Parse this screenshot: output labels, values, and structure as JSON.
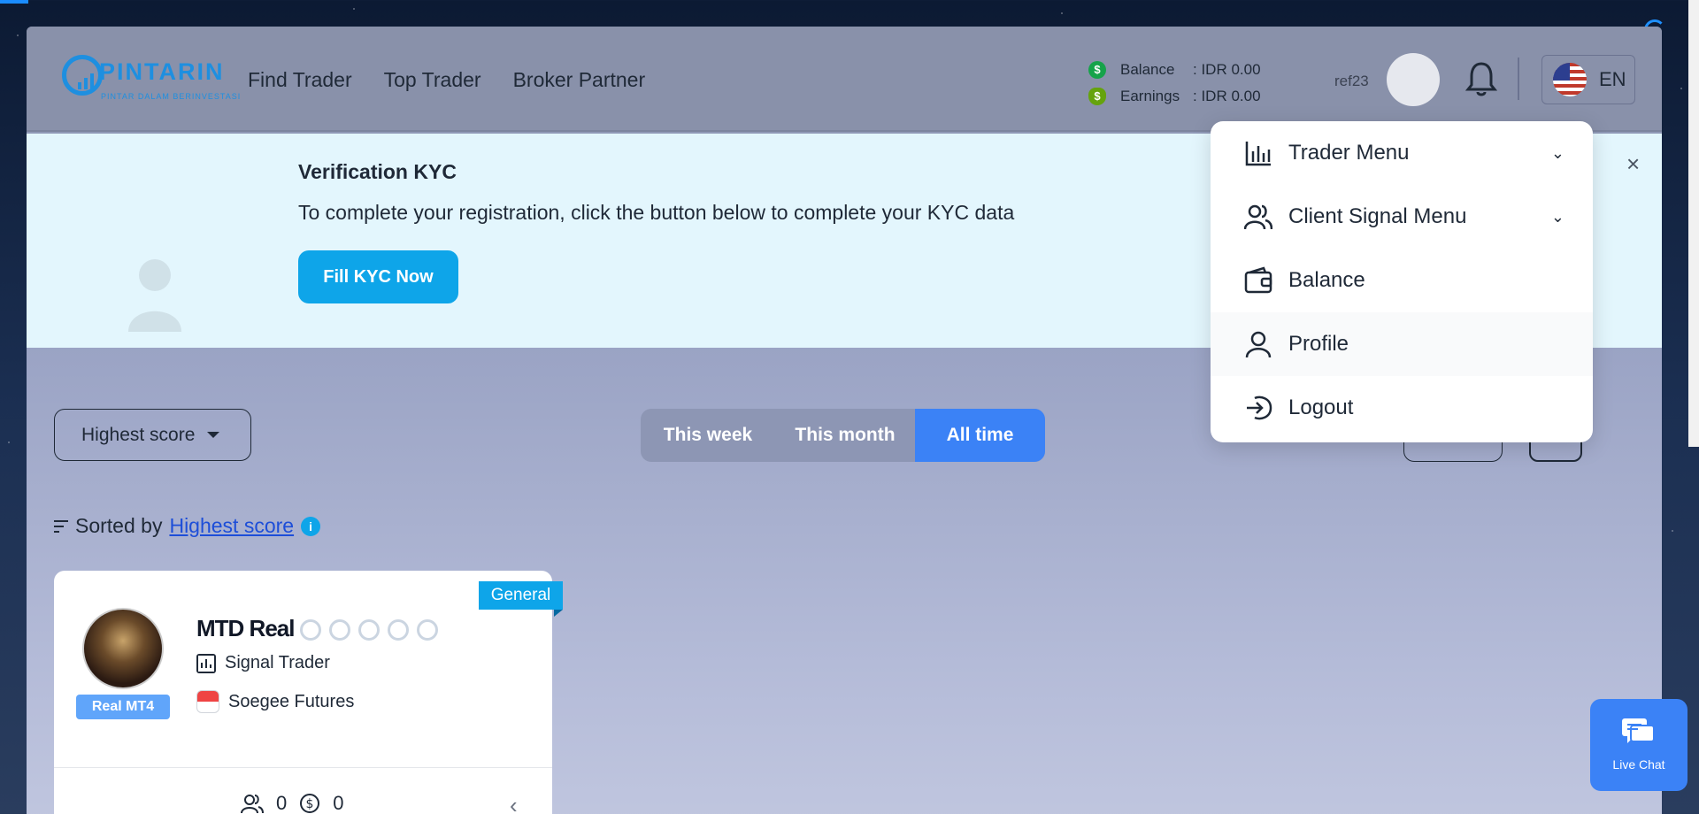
{
  "header": {
    "logo_text": "PINTARIN",
    "logo_tagline": "PINTAR DALAM BERINVESTASI",
    "nav": [
      "Find Trader",
      "Top Trader",
      "Broker Partner"
    ],
    "balance_label": "Balance",
    "balance_value": ": IDR 0.00",
    "earnings_label": "Earnings",
    "earnings_value": ": IDR 0.00",
    "ref": "ref23",
    "language": "EN"
  },
  "kyc": {
    "title": "Verification KYC",
    "description": "To complete your registration, click the button below to complete your KYC data",
    "button": "Fill KYC Now",
    "close": "×"
  },
  "filters": {
    "sort_label": "Highest score",
    "periods": [
      "This week",
      "This month",
      "All time"
    ],
    "active_period": "All time",
    "sorted_by_prefix": "Sorted by",
    "sorted_by_value": "Highest score",
    "info": "i"
  },
  "card": {
    "tag": "General",
    "name": "MTD Real",
    "account_badge": "Real MT4",
    "role": "Signal Trader",
    "broker": "Soegee Futures",
    "followers": "0",
    "earnings": "0",
    "medal_count": 5
  },
  "dropdown": {
    "items": [
      {
        "label": "Trader Menu",
        "icon": "bar-chart-icon",
        "expandable": true
      },
      {
        "label": "Client Signal Menu",
        "icon": "users-icon",
        "expandable": true
      },
      {
        "label": "Balance",
        "icon": "wallet-icon",
        "expandable": false
      },
      {
        "label": "Profile",
        "icon": "user-icon",
        "expandable": false
      },
      {
        "label": "Logout",
        "icon": "logout-icon",
        "expandable": false
      }
    ]
  },
  "live_chat": {
    "label": "Live Chat"
  },
  "colors": {
    "accent": "#3b82f6",
    "kyc_button": "#0ea5e9",
    "kyc_bg": "#e3f6fd",
    "logo": "#1e8fe0"
  }
}
